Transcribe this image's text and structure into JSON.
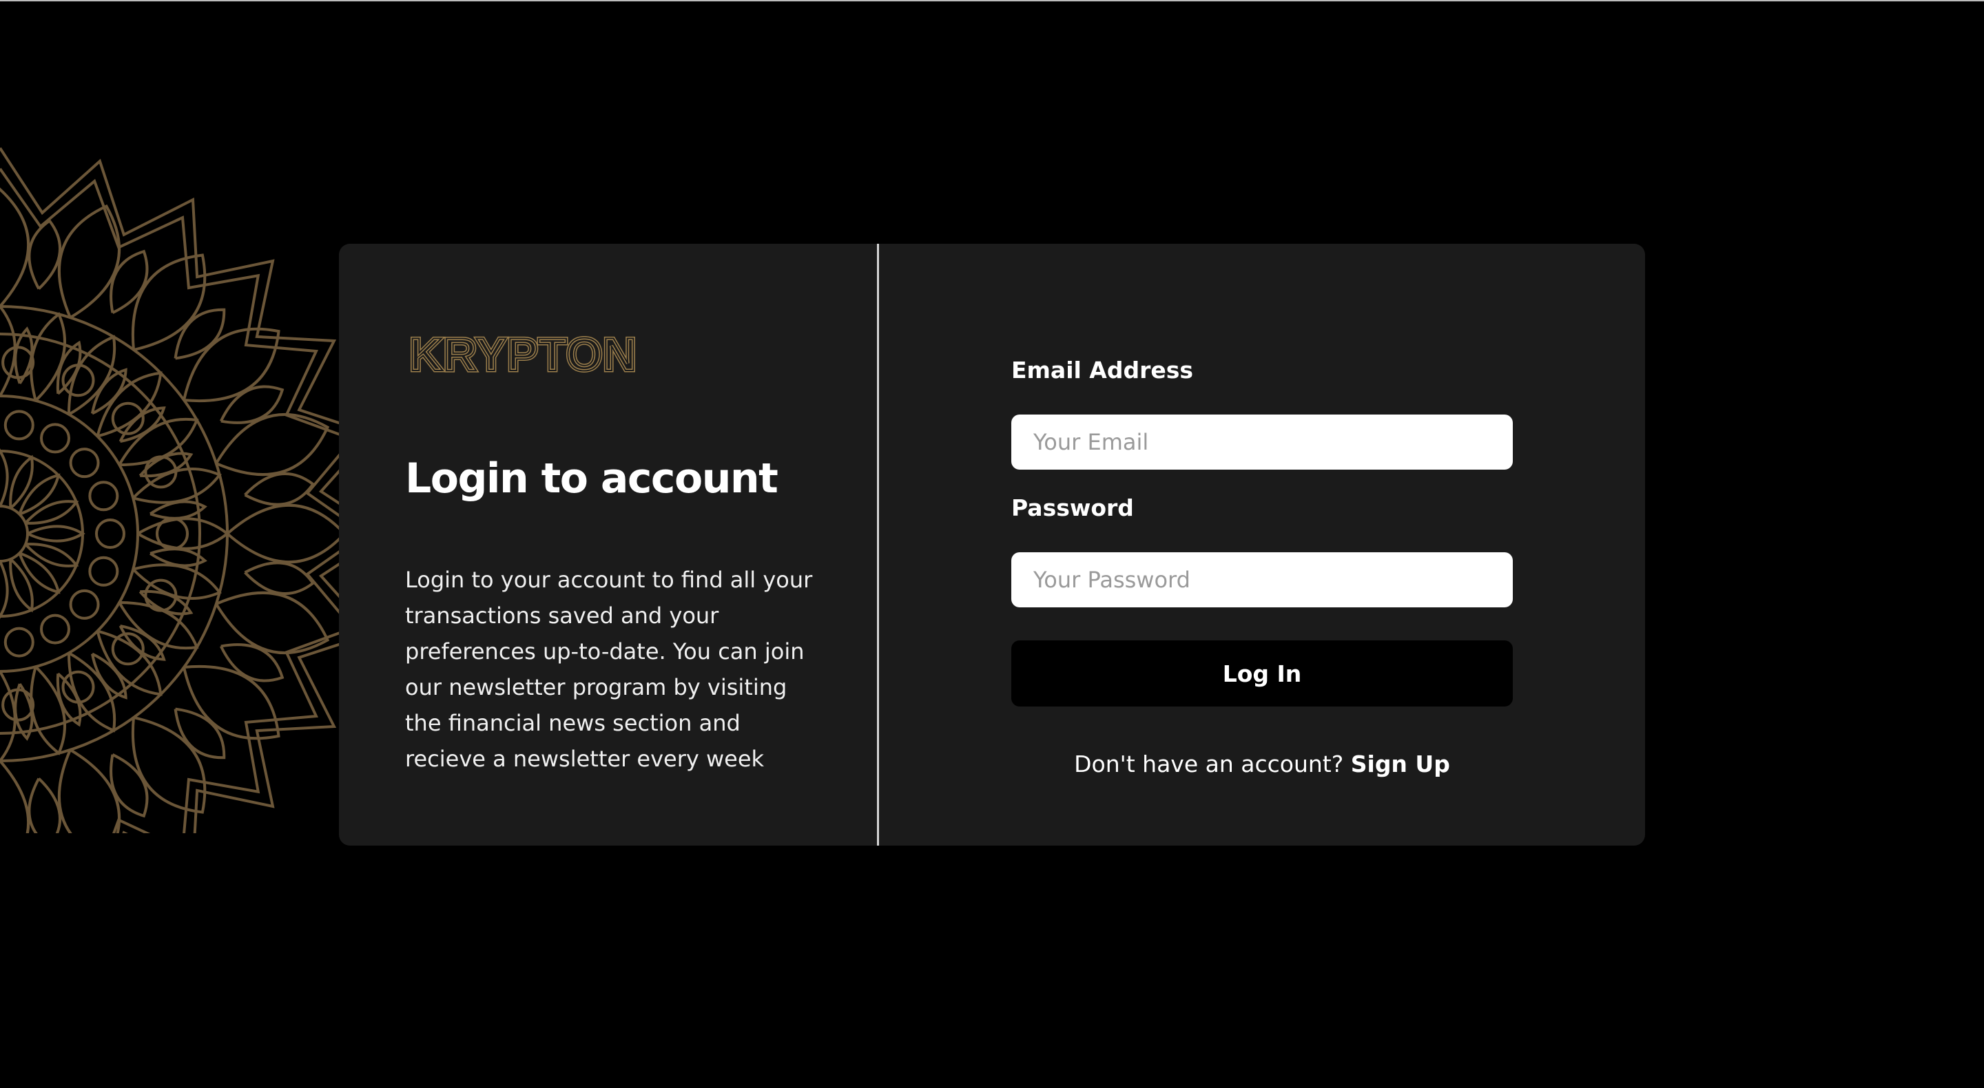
{
  "brand": {
    "logo_text": "KRYPTON",
    "logo_color": "#9c7f4c"
  },
  "intro": {
    "title": "Login to account",
    "description": "Login to your account to find all your transactions saved and your preferences up-to-date. You can join our newsletter program by visiting the financial news section and recieve a newsletter every week"
  },
  "form": {
    "email_label": "Email Address",
    "email_placeholder": "Your Email",
    "email_value": "",
    "password_label": "Password",
    "password_placeholder": "Your Password",
    "password_value": "",
    "submit_label": "Log In"
  },
  "signup": {
    "prompt": "Don't have an account?",
    "link_label": "Sign Up"
  },
  "theme": {
    "background": "#000000",
    "card": "#1b1b1b",
    "accent_gold": "#6b5638"
  },
  "decoration": {
    "icon": "mandala-icon"
  }
}
